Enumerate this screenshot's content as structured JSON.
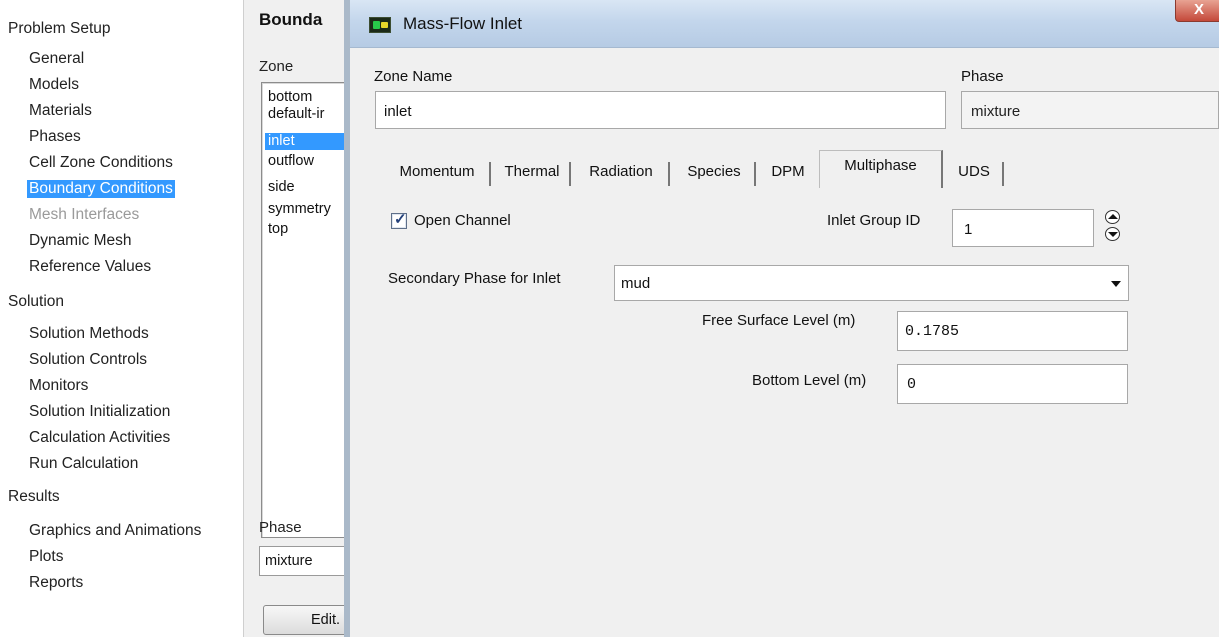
{
  "navigation": {
    "sections": [
      {
        "label": "Problem Setup",
        "items": [
          "General",
          "Models",
          "Materials",
          "Phases",
          "Cell Zone Conditions",
          "Boundary Conditions",
          "Mesh Interfaces",
          "Dynamic Mesh",
          "Reference Values"
        ]
      },
      {
        "label": "Solution",
        "items": [
          "Solution Methods",
          "Solution Controls",
          "Monitors",
          "Solution Initialization",
          "Calculation Activities",
          "Run Calculation"
        ]
      },
      {
        "label": "Results",
        "items": [
          "Graphics and Animations",
          "Plots",
          "Reports"
        ]
      }
    ],
    "selected_item": "Boundary Conditions",
    "disabled_item": "Mesh Interfaces"
  },
  "boundary_panel": {
    "title": "Bounda",
    "zone_label": "Zone",
    "zones": [
      "bottom",
      "default-ir",
      "inlet",
      "outflow",
      "side",
      "symmetry",
      "top"
    ],
    "selected_zone": "inlet",
    "phase_label": "Phase",
    "phase_value": "mixture",
    "edit_label": "Edit."
  },
  "dialog": {
    "title": "Mass-Flow Inlet",
    "close_label": "X",
    "zone_name_label": "Zone Name",
    "zone_name_value": "inlet",
    "phase_label": "Phase",
    "phase_value": "mixture",
    "tabs": [
      "Momentum",
      "Thermal",
      "Radiation",
      "Species",
      "DPM",
      "Multiphase",
      "UDS"
    ],
    "active_tab": "Multiphase",
    "multiphase": {
      "open_channel_label": "Open Channel",
      "open_channel_checked": true,
      "inlet_group_id_label": "Inlet Group ID",
      "inlet_group_id_value": "1",
      "secondary_phase_label": "Secondary Phase for Inlet",
      "secondary_phase_value": "mud",
      "free_surface_label": "Free Surface Level (m)",
      "free_surface_value": "0.1785",
      "bottom_level_label": "Bottom Level (m)",
      "bottom_level_value": "0"
    }
  },
  "colors": {
    "selection": "#3399ff",
    "dialog_bg": "#f0f0f0",
    "titlebar": "#c3d6ec",
    "close_button": "#c4493a"
  }
}
